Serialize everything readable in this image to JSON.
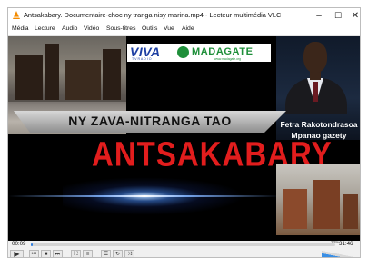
{
  "window": {
    "title": "Antsakabary. Documentaire-choc ny tranga nisy marina.mp4 - Lecteur multimédia VLC",
    "controls": {
      "minimize": "–",
      "maximize": "☐",
      "close": "✕"
    }
  },
  "menu": [
    "Média",
    "Lecture",
    "Audio",
    "Vidéo",
    "Sous-titres",
    "Outils",
    "Vue",
    "Aide"
  ],
  "video": {
    "logo_left": "VIVA",
    "logo_left_sub": "T V   R A D I O",
    "logo_right": "MADAGATE",
    "logo_right_sub": "www.madagate.org",
    "tagline": "NY ZAVA-NITRANGA TAO",
    "headline": "ANTSAKABARY",
    "person_name": "Fetra Rakotondrasoa",
    "person_role": "Mpanao gazety"
  },
  "player": {
    "elapsed": "00:09",
    "total": "31:46",
    "progress": 0.005,
    "volume_label": "33%",
    "volume_level": 0.33
  },
  "icons": [
    "vlc-cone-icon",
    "play-icon",
    "previous-icon",
    "stop-icon",
    "next-icon",
    "fullscreen-icon",
    "extended-settings-icon",
    "playlist-icon",
    "loop-icon",
    "shuffle-icon"
  ],
  "colors": {
    "headline": "#e21d1d",
    "progress": "#2f7fe0",
    "vlc_orange": "#f48b00"
  }
}
